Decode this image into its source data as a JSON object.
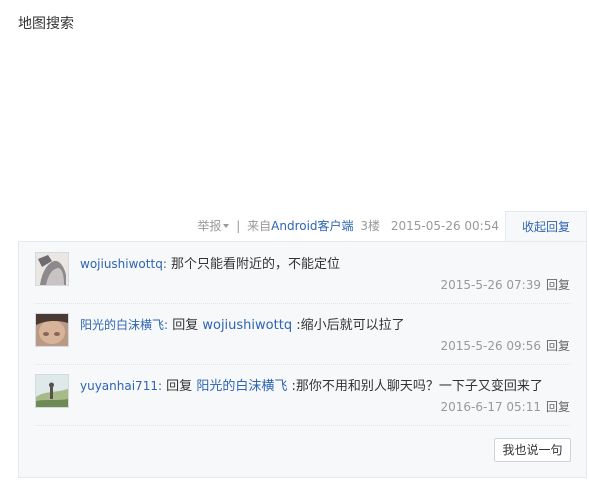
{
  "post": {
    "body_text": "地图搜索"
  },
  "tail": {
    "report_label": "举报",
    "separator": "|",
    "source_prefix": "来自",
    "client_name": "Android客户端",
    "floor": "3楼",
    "time": "2015-05-26 00:54",
    "collapse_label": "收起回复"
  },
  "replies": [
    {
      "username": "wojiushiwottq",
      "colon": ":",
      "reply_word": "",
      "reply_target": "",
      "text": "那个只能看附近的，不能定位",
      "time": "2015-5-26 07:39",
      "reply_label": "回复",
      "avatar_icon": "user-avatar-photo"
    },
    {
      "username": "阳光的白沫横飞",
      "colon": ":",
      "reply_word": "回复",
      "reply_target": "wojiushiwottq",
      "text": ":缩小后就可以拉了",
      "time": "2015-5-26 09:56",
      "reply_label": "回复",
      "avatar_icon": "user-avatar-photo"
    },
    {
      "username": "yuyanhai711",
      "colon": ":",
      "reply_word": "回复",
      "reply_target": "阳光的白沫横飞",
      "text": ":那你不用和别人聊天吗？一下子又变回来了",
      "time": "2016-6-17 05:11",
      "reply_label": "回复",
      "avatar_icon": "user-avatar-photo"
    }
  ],
  "say_button_label": "我也说一句",
  "colors": {
    "link": "#2d64b3",
    "meta": "#999999",
    "panel_bg": "#f7f8fa",
    "panel_border": "#e5e9ef"
  }
}
